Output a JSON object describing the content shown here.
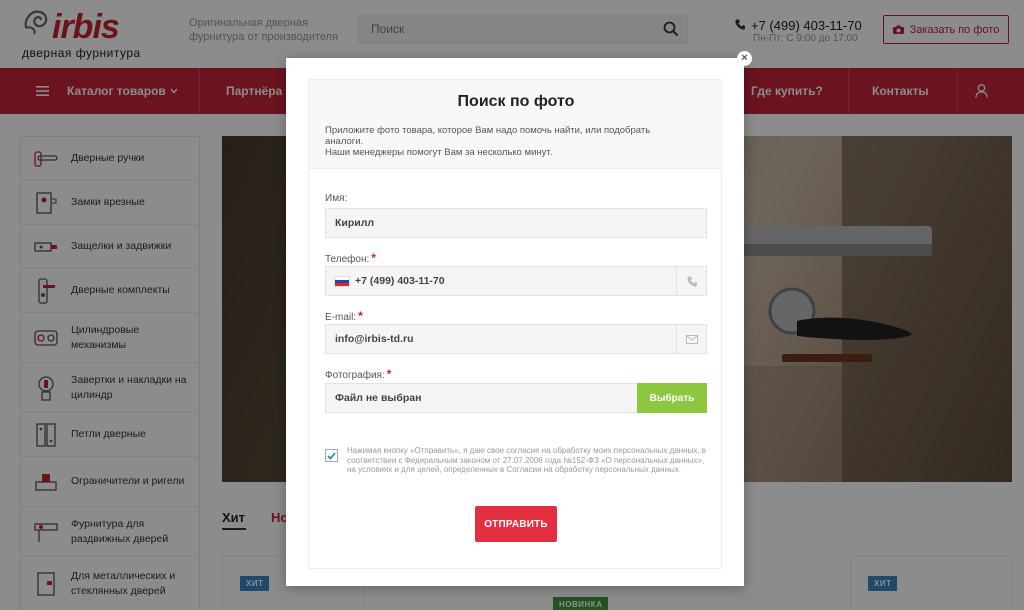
{
  "header": {
    "logo_text": "irbis",
    "logo_subtitle": "дверная фурнитура",
    "tagline": "Оригинальная дверная фурнитура от производителя",
    "search_placeholder": "Поиск",
    "phone": "+7 (499) 403-11-70",
    "hours": "Пн-Пт: С 9:00 до 17:00",
    "order_button": "Заказать по фото"
  },
  "nav": {
    "catalog": "Каталог товаров",
    "partners": "Партнёра",
    "where_to_buy": "Где купить?",
    "contacts": "Контакты"
  },
  "sidebar": {
    "items": [
      {
        "label": "Дверные ручки",
        "icon": "door-handle-icon"
      },
      {
        "label": "Замки врезные",
        "icon": "mortise-lock-icon"
      },
      {
        "label": "Защелки и задвижки",
        "icon": "latch-icon"
      },
      {
        "label": "Дверные комплекты",
        "icon": "door-set-icon"
      },
      {
        "label": "Цилиндровые механизмы",
        "icon": "cylinder-icon"
      },
      {
        "label": "Завертки и накладки на цилиндр",
        "icon": "cylinder-cover-icon"
      },
      {
        "label": "Петли дверные",
        "icon": "hinge-icon"
      },
      {
        "label": "Ограничители и ригели",
        "icon": "door-stopper-icon"
      },
      {
        "label": "Фурнитура для раздвижных дверей",
        "icon": "sliding-door-icon"
      },
      {
        "label": "Для металлических и стеклянных дверей",
        "icon": "metal-door-icon"
      }
    ]
  },
  "tabs": {
    "hit": "Хит",
    "new_partial": "Но"
  },
  "badges": {
    "hit": "ХИТ",
    "new": "НОВИНКА"
  },
  "modal": {
    "title": "Поиск по фото",
    "description": "Приложите фото товара, которое Вам надо помочь найти, или подобрать аналоги.\nНаши менеджеры помогут Вам за несколько минут.",
    "name_label": "Имя:",
    "name_value": "Кирилл",
    "phone_label": "Телефон:",
    "phone_value": "+7 (499) 403-11-70",
    "email_label": "E-mail:",
    "email_value": "info@irbis-td.ru",
    "photo_label": "Фотография:",
    "photo_value": "Файл не выбран",
    "choose_button": "Выбрать",
    "consent_text": "Нажимая кнопку «Отправить», я даю свое согласие на обработку моих персональных данных, в соответствии с Федеральным законом от 27.07.2006 года №152-ФЗ «О персональных данных», на условиях и для целей, определенных в Согласии на обработку персональных данных.",
    "consent_checked": true,
    "submit_button": "ОТПРАВИТЬ",
    "required_mark": "*",
    "close_glyph": "×"
  },
  "colors": {
    "brand_red": "#c4243a",
    "accent_green": "#8dc63f",
    "submit_red": "#e33040",
    "badge_blue": "#3a87c6",
    "badge_green": "#3c9a3c"
  }
}
